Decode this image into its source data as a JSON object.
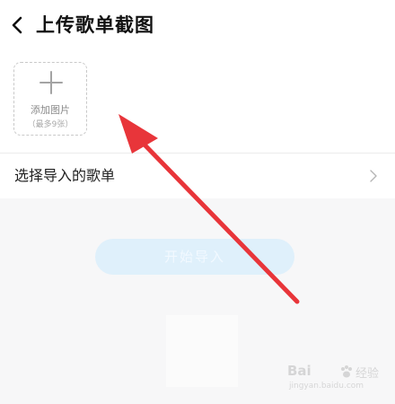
{
  "header": {
    "title": "上传歌单截图"
  },
  "upload": {
    "add_label": "添加图片",
    "max_label": "（最多9张）"
  },
  "select_row": {
    "label": "选择导入的歌单"
  },
  "actions": {
    "start_label": "开始导入"
  },
  "watermark": {
    "brand": "Bai",
    "brand_cn": "经验",
    "url": "jingyan.baidu.com"
  },
  "icons": {
    "back": "chevron-left-icon",
    "plus": "plus-icon",
    "chevron": "chevron-right-icon",
    "arrow": "red-arrow-annotation"
  },
  "colors": {
    "accent_disabled": "#dff0fb",
    "annotation_arrow": "#e8353a",
    "background": "#f7f7f8"
  }
}
